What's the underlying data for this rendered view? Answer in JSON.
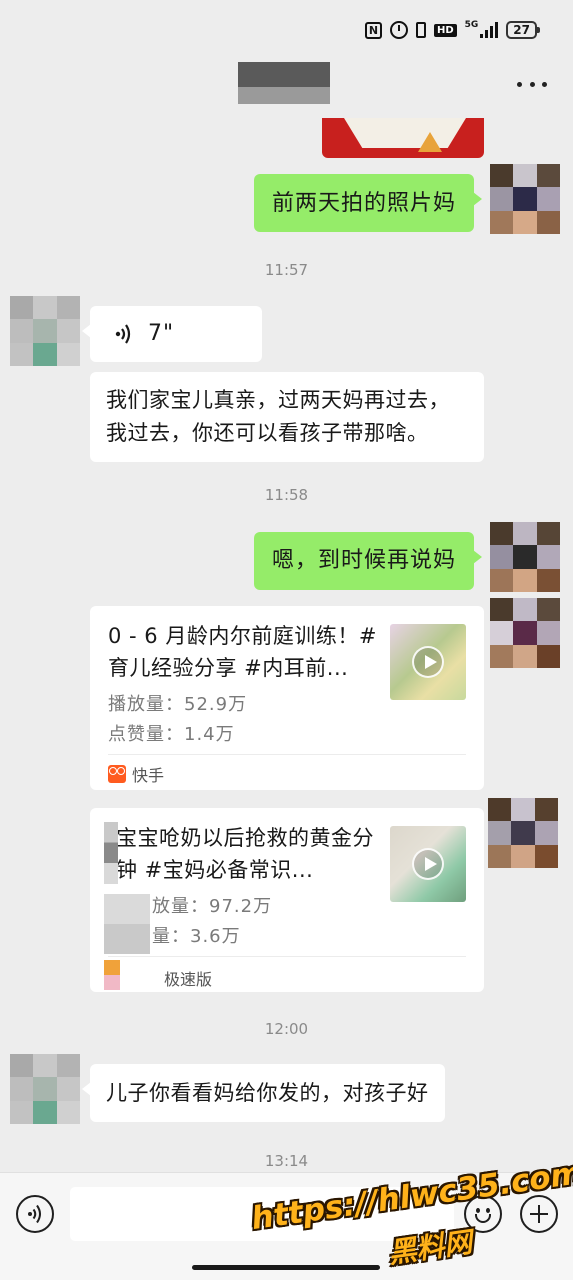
{
  "status_bar": {
    "nfc_icon": "N",
    "hd_label": "HD",
    "network": "5G",
    "battery": "27"
  },
  "title_bar": {
    "more_icon": "more-dots-icon"
  },
  "messages": {
    "m1": "前两天拍的照片妈",
    "t1": "11:57",
    "voice_duration": "7\"",
    "m2_line1": "我们家宝儿真亲，过两天妈再过去，",
    "m2_line2": "我过去，你还可以看孩子带那啥。",
    "t2": "11:58",
    "m3": "嗯，到时候再说妈",
    "card1": {
      "title": "0 - 6 月龄内尔前庭训练！#育儿经验分享 #内耳前...",
      "plays": "播放量：52.9万",
      "likes": "点赞量：1.4万",
      "source": "快手"
    },
    "card2": {
      "title": "宝宝呛奶以后抢救的黄金分钟 #宝妈必备常识...",
      "plays": "放量：97.2万",
      "likes": "量：3.6万",
      "source": "极速版"
    },
    "t3": "12:00",
    "m4": "儿子你看看妈给你发的，对孩子好",
    "t4": "13:14"
  },
  "input_bar": {
    "placeholder": ""
  },
  "watermark": {
    "url": "https://hlwc35.com",
    "name": "黑料网"
  },
  "colors": {
    "bg": "#ededed",
    "bubble_green": "#95ec69",
    "bubble_white": "#ffffff",
    "source_logo": "#ff5b1f",
    "watermark": "#ffb21a"
  }
}
